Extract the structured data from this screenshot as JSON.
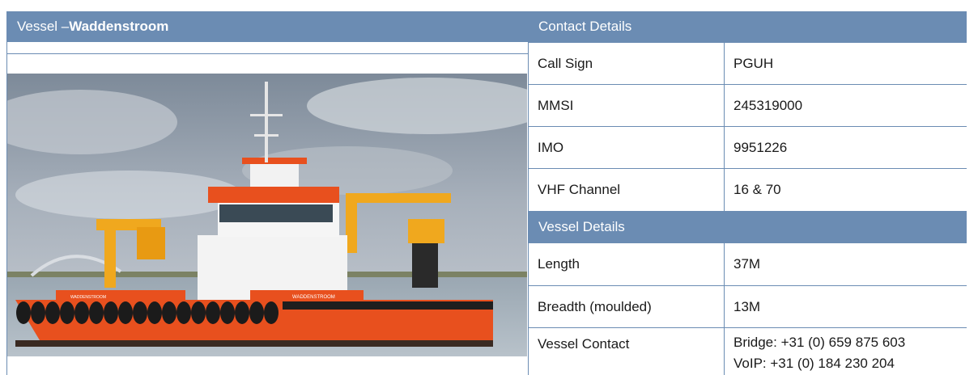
{
  "vessel_header": {
    "prefix": "Vessel – ",
    "name": "Waddenstroom"
  },
  "photo": {
    "caption_on_hull": "WADDENSTROOM",
    "bow_name": "WADDENSTROOM"
  },
  "contact_header": "Contact Details",
  "contact_rows": [
    {
      "label": "Call Sign",
      "value": "PGUH"
    },
    {
      "label": "MMSI",
      "value": "245319000"
    },
    {
      "label": "IMO",
      "value": "9951226"
    },
    {
      "label": "VHF Channel",
      "value": "16 & 70"
    }
  ],
  "vessel_details_header": "Vessel Details",
  "vessel_rows": [
    {
      "label": "Length",
      "value": "37M"
    },
    {
      "label": "Breadth (moulded)",
      "value": "13M"
    }
  ],
  "vessel_contact": {
    "label": "Vessel Contact",
    "bridge": "Bridge: +31 (0) 659 875 603",
    "voip": "VoIP: +31 (0) 184 230 204"
  },
  "colors": {
    "header_bg": "#6b8cb3",
    "hull_orange": "#e8501e",
    "crane_yellow": "#f0a81e"
  }
}
